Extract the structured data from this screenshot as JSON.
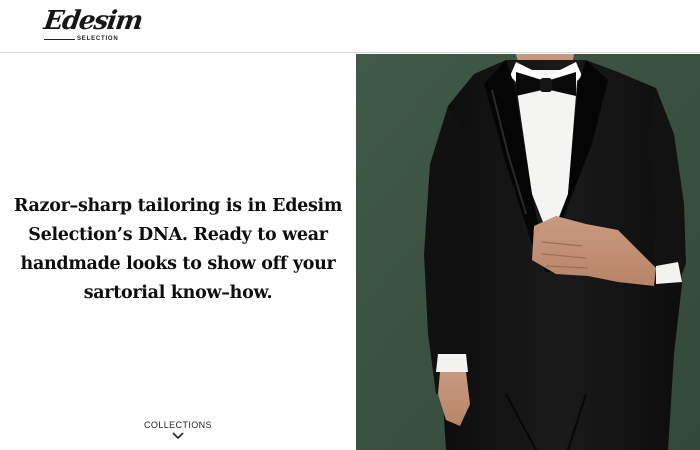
{
  "header": {
    "logo_text": "Edesim",
    "logo_subtext": "SELECTION"
  },
  "hero": {
    "tagline_lines": [
      "Razor–sharp tailoring is in Edesim",
      "Selection’s DNA. Ready to wear",
      "handmade looks to show off your",
      "sartorial know–how."
    ],
    "collections_label": "COLLECTIONS",
    "image": "man-in-black-tuxedo-photo"
  },
  "colors": {
    "backdrop": "#3d5543",
    "suit": "#141414",
    "shirt": "#f4f4f2",
    "text": "#0e0e0e"
  }
}
